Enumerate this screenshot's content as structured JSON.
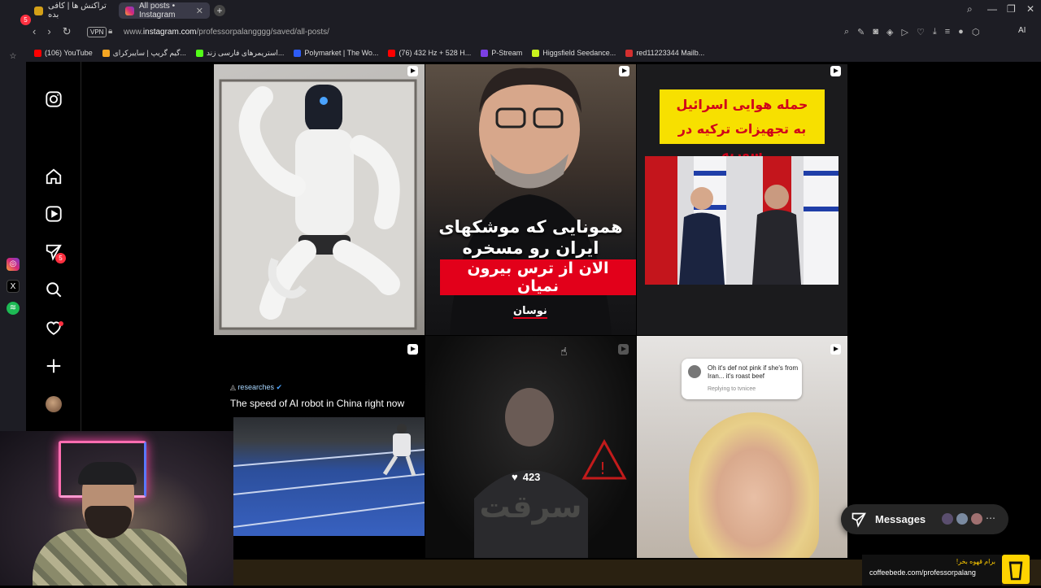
{
  "browser": {
    "tabs": [
      {
        "label": "تراکنش ها | کافی بده",
        "active": false
      },
      {
        "label": "All posts • Instagram",
        "active": true
      }
    ],
    "new_tab": "+",
    "url_prefix": "www.",
    "url_domain": "instagram.com",
    "url_path": "/professorpalangggg/saved/all-posts/",
    "vpn_label": "VPN",
    "ai_label": "AI",
    "bookmarks": [
      {
        "label": "(106) YouTube",
        "color": "#ff0000"
      },
      {
        "label": "گیم گریپ | سایبرکرای...",
        "color": "#f5a623"
      },
      {
        "label": "استریمرهای فارسی زند...",
        "color": "#53fc18"
      },
      {
        "label": "Polymarket | The Wo...",
        "color": "#2d5cf6"
      },
      {
        "label": "(76) 432 Hz + 528 H...",
        "color": "#ff0000"
      },
      {
        "label": "P-Stream",
        "color": "#7b3fe4"
      },
      {
        "label": "Higgsfield Seedance...",
        "color": "#c9f31d"
      },
      {
        "label": "red11223344 Mailb...",
        "color": "#d32f2f"
      }
    ]
  },
  "instagram": {
    "messages_badge": "5",
    "messages_label": "Messages",
    "posts": {
      "p2": {
        "line1": "همونایی که موشکهای",
        "line2": "ایران رو مسخره می‌کردند",
        "line3": "الان از ترس بیرون نمیان",
        "logo": "نوسان"
      },
      "p3": {
        "banner_line1": "حمله هوایی اسرائیل",
        "banner_line2": "به تجهیزات ترکیه در سوریه"
      },
      "p4": {
        "account": "researches",
        "caption": "The speed of AI robot in China right now"
      },
      "p5": {
        "likes": "423",
        "overlay_text": "سرقت"
      },
      "p6": {
        "comment": "Oh it's def not pink if she's from Iran... it's roast beef",
        "replying": "Replying to tvnicee"
      }
    }
  },
  "coffee": {
    "fa": "برام قهوه بخر!",
    "url": "coffeebede.com/professorpalang"
  }
}
